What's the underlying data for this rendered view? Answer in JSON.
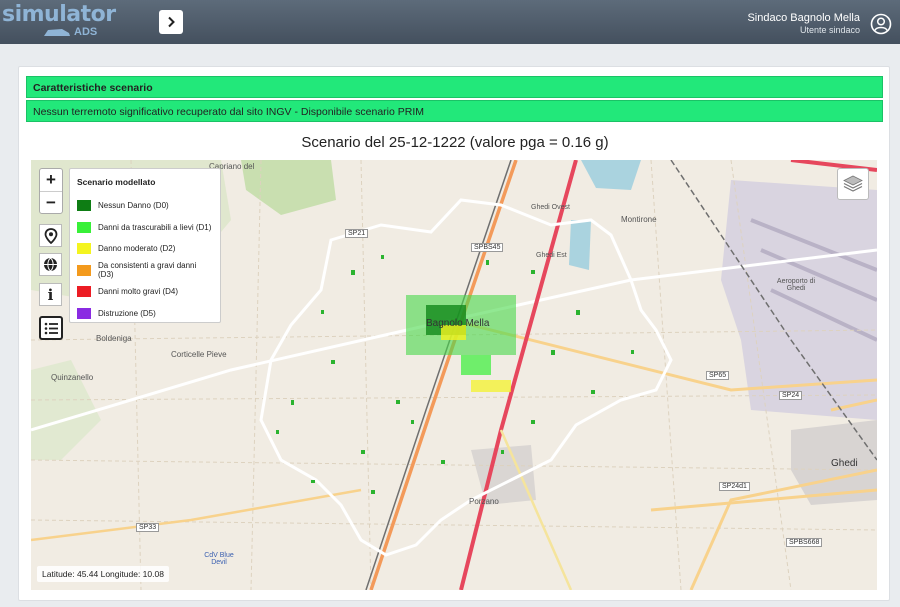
{
  "header": {
    "logo_text": "simulator",
    "logo_sub": "ADS",
    "user_name": "Sindaco Bagnolo Mella",
    "user_role": "Utente sindaco"
  },
  "banner": {
    "title": "Caratteristiche scenario",
    "message": "Nessun terremoto significativo recuperato dal sito INGV - Disponibile scenario PRIM"
  },
  "scenario_title": "Scenario del 25-12-1222 (valore pga = 0.16 g)",
  "map": {
    "coords": "Latitude: 45.44 Longitude: 10.08",
    "legend": {
      "title": "Scenario modellato",
      "items": [
        {
          "label": "Nessun Danno (D0)",
          "color": "#0e7d14"
        },
        {
          "label": "Danni da trascurabili a lievi (D1)",
          "color": "#38f038"
        },
        {
          "label": "Danno moderato (D2)",
          "color": "#f4f41f"
        },
        {
          "label": "Da consistenti a gravi danni (D3)",
          "color": "#f39a1d"
        },
        {
          "label": "Danni molto gravi (D4)",
          "color": "#ec1c24"
        },
        {
          "label": "Distruzione (D5)",
          "color": "#8a2be2"
        }
      ]
    },
    "places": [
      {
        "id": "capriano",
        "label": "Capriano del"
      },
      {
        "id": "montirone",
        "label": "Montirone"
      },
      {
        "id": "ghedi-ovest",
        "label": "Ghedi Ovest"
      },
      {
        "id": "ghedi-est",
        "label": "Ghedi Est"
      },
      {
        "id": "bagnolo",
        "label": "Bagnolo Mella"
      },
      {
        "id": "boldeniga",
        "label": "Boldeniga"
      },
      {
        "id": "corticelle",
        "label": "Corticelle Pieve"
      },
      {
        "id": "quinzanello",
        "label": "Quinzanello"
      },
      {
        "id": "porzano",
        "label": "Porzano"
      },
      {
        "id": "ghedi",
        "label": "Ghedi"
      },
      {
        "id": "aeroporto",
        "label": "Aeroporto di Ghedi"
      },
      {
        "id": "cdv",
        "label": "CdV Blue Devil"
      }
    ],
    "roads": [
      {
        "id": "sp21",
        "label": "SP21"
      },
      {
        "id": "spbs45",
        "label": "SPBS45"
      },
      {
        "id": "sp65",
        "label": "SP65"
      },
      {
        "id": "sp24",
        "label": "SP24"
      },
      {
        "id": "sp24d1",
        "label": "SP24d1"
      },
      {
        "id": "spbs668",
        "label": "SPBS668"
      },
      {
        "id": "sp33",
        "label": "SP33"
      }
    ]
  }
}
